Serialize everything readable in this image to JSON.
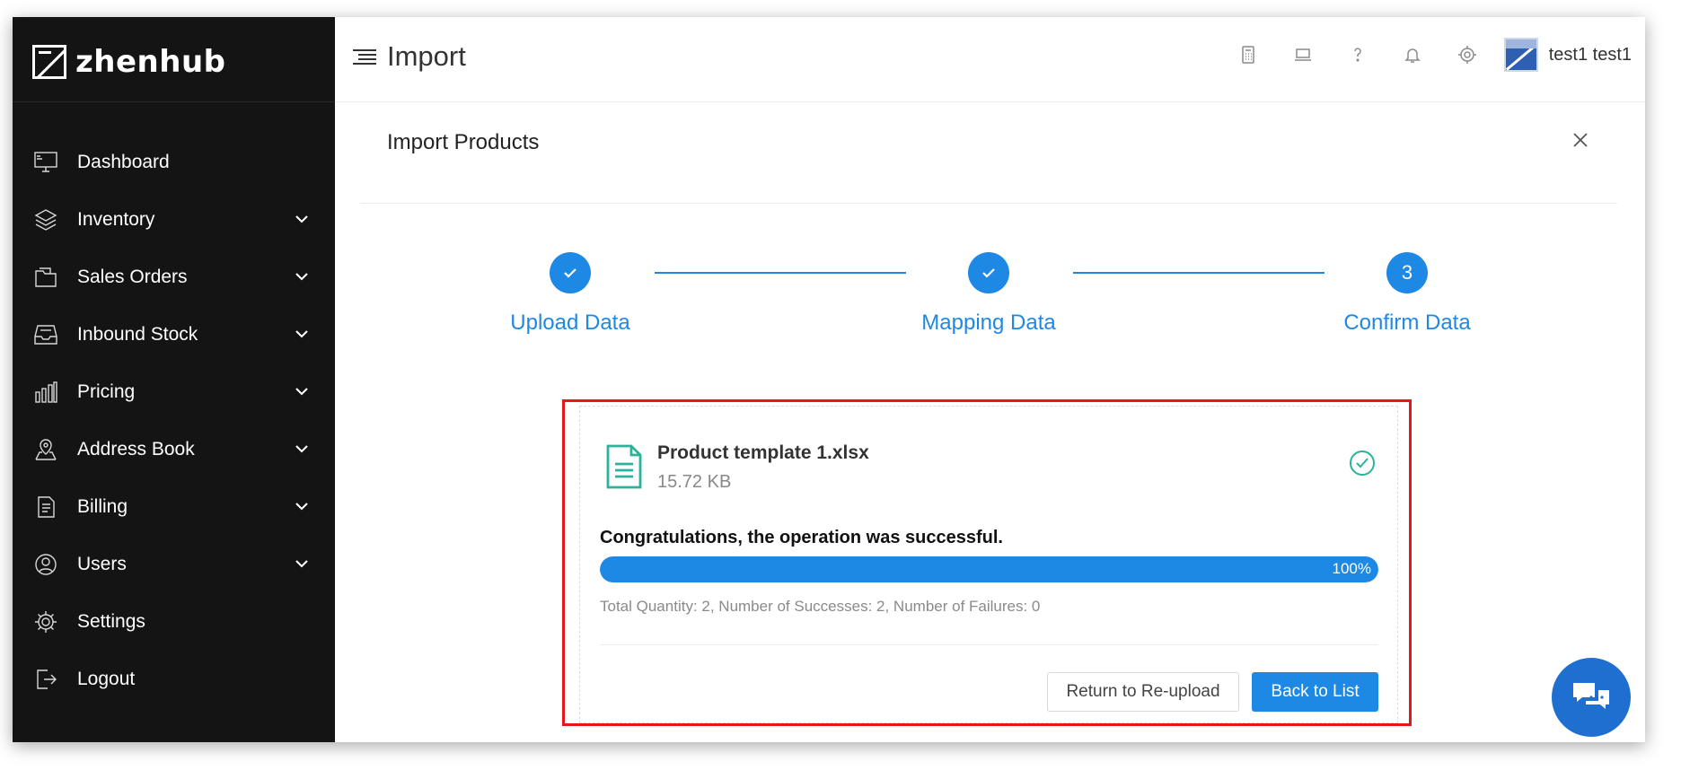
{
  "brand": {
    "name": "zhenhub"
  },
  "sidebar": {
    "items": [
      {
        "label": "Dashboard",
        "icon": "monitor-icon",
        "expandable": false
      },
      {
        "label": "Inventory",
        "icon": "layers-icon",
        "expandable": true
      },
      {
        "label": "Sales Orders",
        "icon": "folder-icon",
        "expandable": true
      },
      {
        "label": "Inbound Stock",
        "icon": "inbox-icon",
        "expandable": true
      },
      {
        "label": "Pricing",
        "icon": "bar-chart-icon",
        "expandable": true
      },
      {
        "label": "Address Book",
        "icon": "map-pin-icon",
        "expandable": true
      },
      {
        "label": "Billing",
        "icon": "invoice-icon",
        "expandable": true
      },
      {
        "label": "Users",
        "icon": "user-globe-icon",
        "expandable": true
      },
      {
        "label": "Settings",
        "icon": "gear-icon",
        "expandable": false
      },
      {
        "label": "Logout",
        "icon": "logout-icon",
        "expandable": false
      }
    ]
  },
  "header": {
    "title": "Import",
    "icons": [
      "calculator-icon",
      "laptop-icon",
      "help-icon",
      "bell-icon",
      "settings-icon"
    ],
    "user": "test1 test1"
  },
  "panel": {
    "title": "Import Products",
    "steps": [
      {
        "label": "Upload Data",
        "state": "done"
      },
      {
        "label": "Mapping Data",
        "state": "done"
      },
      {
        "label": "Confirm Data",
        "state": "active",
        "number": "3"
      }
    ],
    "result": {
      "file_name": "Product template 1.xlsx",
      "file_size": "15.72 KB",
      "message": "Congratulations, the operation was successful.",
      "progress_percent": 100,
      "progress_label": "100%",
      "summary": "Total Quantity: 2, Number of Successes: 2, Number of Failures: 0"
    },
    "buttons": {
      "reupload": "Return to Re-upload",
      "back": "Back to List"
    }
  },
  "colors": {
    "primary": "#1e88e5",
    "sidebar_bg": "#141414",
    "success": "#2bb39a",
    "highlight": "#e31919"
  }
}
